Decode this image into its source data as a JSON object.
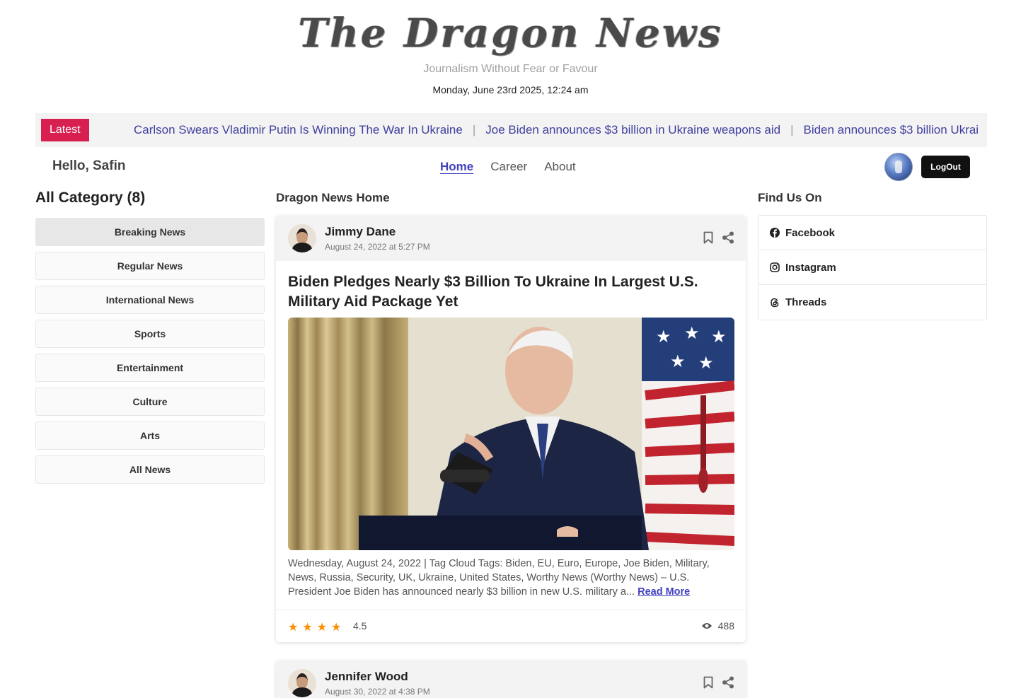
{
  "header": {
    "logo": "The Dragon News",
    "tagline": "Journalism Without Fear or Favour",
    "datetime": "Monday, June 23rd 2025, 12:24 am"
  },
  "ticker": {
    "badge": "Latest",
    "items": [
      "Carlson Swears Vladimir Putin Is Winning The War In Ukraine",
      "Joe Biden announces $3 billion in Ukraine weapons aid",
      "Biden announces $3 billion Ukrai"
    ]
  },
  "navbar": {
    "greeting": "Hello, Safin",
    "links": [
      "Home",
      "Career",
      "About"
    ],
    "logout_label": "LogOut"
  },
  "categories": {
    "title": "All Category (8)",
    "items": [
      "Breaking News",
      "Regular News",
      "International News",
      "Sports",
      "Entertainment",
      "Culture",
      "Arts",
      "All News"
    ]
  },
  "main": {
    "title": "Dragon News Home",
    "articles": [
      {
        "author": "Jimmy Dane",
        "date": "August 24, 2022 at 5:27 PM",
        "title": "Biden Pledges Nearly $3 Billion To Ukraine In Largest U.S. Military Aid Package Yet",
        "excerpt": "Wednesday, August 24, 2022 | Tag Cloud Tags: Biden, EU, Euro, Europe, Joe Biden, Military, News, Russia, Security, UK, Ukraine, United States, Worthy News (Worthy News) – U.S. President Joe Biden has announced nearly $3 billion in new U.S. military a...",
        "read_more": "Read More",
        "rating": "4.5",
        "stars_filled": 4,
        "views": "488"
      },
      {
        "author": "Jennifer Wood",
        "date": "August 30, 2022 at 4:38 PM"
      }
    ]
  },
  "sidebar_right": {
    "title": "Find Us On",
    "links": [
      "Facebook",
      "Instagram",
      "Threads"
    ]
  },
  "colors": {
    "accent": "#403fbf",
    "badge": "#d72050",
    "star": "#ff8c00"
  }
}
